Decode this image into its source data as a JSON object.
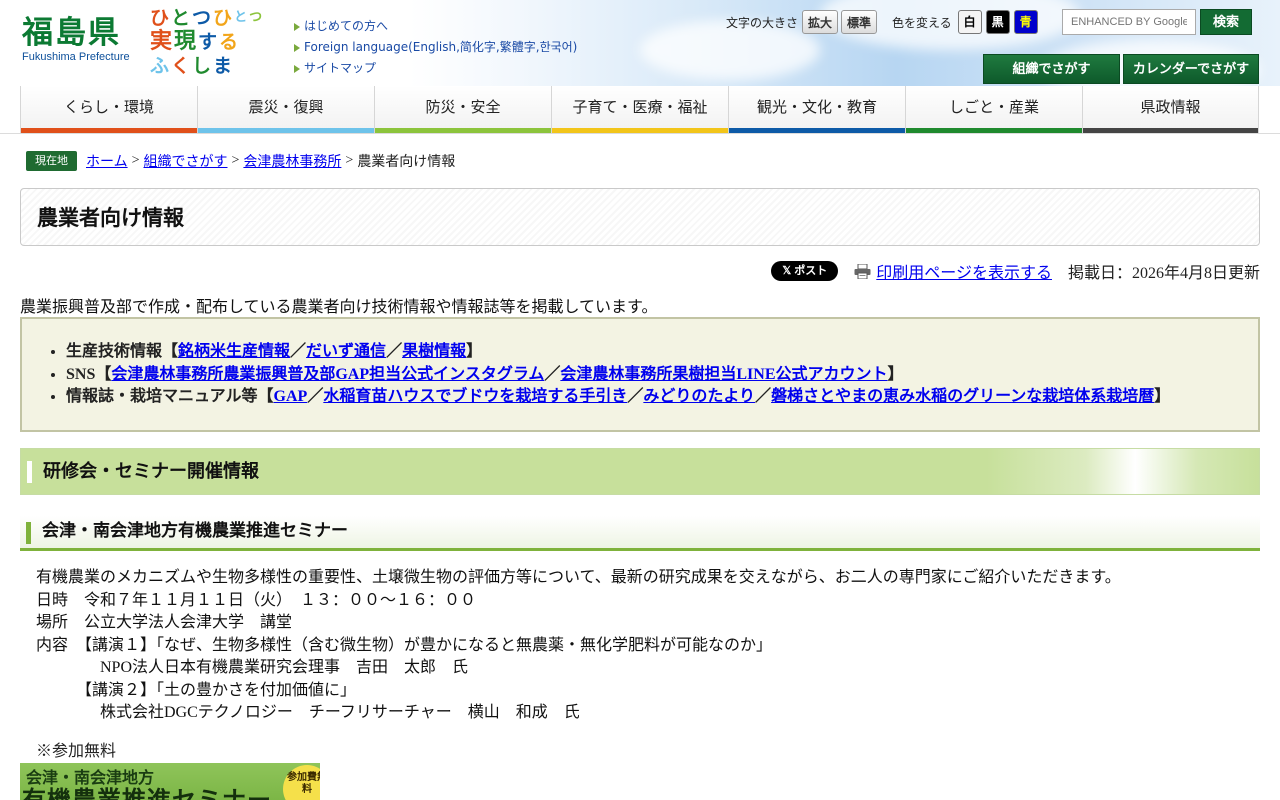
{
  "header": {
    "logo_kanji": "福島県",
    "logo_roman": "Fukushima Prefecture",
    "slogan_chars": [
      "ひ",
      "と",
      "つ",
      "ひ",
      "と",
      "つ",
      "実",
      "現",
      "す",
      "る",
      "ふ",
      "く",
      "し",
      "ま"
    ],
    "top_links": [
      "はじめての方へ",
      "Foreign language(English,简化字,繁體字,한국어)",
      "サイトマップ"
    ],
    "font_size_label": "文字の大きさ",
    "font_enlarge": "拡大",
    "font_standard": "標準",
    "color_change_label": "色を変える",
    "color_white": "白",
    "color_black": "黒",
    "color_blue": "青",
    "search_placeholder": "ENHANCED BY Google",
    "search_button": "検索",
    "org_search_button": "組織でさがす",
    "calendar_search_button": "カレンダーでさがす"
  },
  "nav": [
    {
      "label": "くらし・環境",
      "color": "#e0501a"
    },
    {
      "label": "震災・復興",
      "color": "#6ec3ea"
    },
    {
      "label": "防災・安全",
      "color": "#8cc43c"
    },
    {
      "label": "子育て・医療・福祉",
      "color": "#f2c51a"
    },
    {
      "label": "観光・文化・教育",
      "color": "#0d5aa7"
    },
    {
      "label": "しごと・産業",
      "color": "#1f8a2e"
    },
    {
      "label": "県政情報",
      "color": "#444444"
    }
  ],
  "breadcrumb": {
    "here_label": "現在地",
    "items": [
      "ホーム",
      "組織でさがす",
      "会津農林事務所"
    ],
    "current": "農業者向け情報",
    "separator": ">"
  },
  "page": {
    "title": "農業者向け情報",
    "x_post": "𝕏 ポスト",
    "print_link": "印刷用ページを表示する",
    "updated": "掲載日：2026年4月8日更新",
    "intro": "農業振興普及部で作成・配布している農業者向け技術情報や情報誌等を掲載しています。"
  },
  "linkbox": {
    "rows": [
      {
        "prefix": "生産技術情報【",
        "links": [
          "銘柄米生産情報",
          "だいず通信",
          "果樹情報"
        ],
        "suffix": "】"
      },
      {
        "prefix": "SNS【",
        "links": [
          "会津農林事務所農業振興普及部GAP担当公式インスタグラム",
          "会津農林事務所果樹担当LINE公式アカウント"
        ],
        "suffix": "】"
      },
      {
        "prefix": "情報誌・栽培マニュアル等【",
        "links": [
          "GAP",
          "水稲育苗ハウスでブドウを栽培する手引き",
          "みどりのたより",
          "磐梯さとやまの恵み水稲のグリーンな栽培体系栽培暦"
        ],
        "suffix": "】"
      }
    ],
    "delimiter": "／"
  },
  "section": {
    "h2": "研修会・セミナー開催情報",
    "h3": "会津・南会津地方有機農業推進セミナー",
    "lines": [
      "有機農業のメカニズムや生物多様性の重要性、土壌微生物の評価方等について、最新の研究成果を交えながら、お二人の専門家にご紹介いただきます。",
      "日時　令和７年１１月１１日（火）　１３：００～１６：００",
      "場所　公立大学法人会津大学　講堂",
      "内容　【講演１】「なぜ、生物多様性（含む微生物）が豊かになると無農薬・無化学肥料が可能なのか」",
      "　　　　NPO法人日本有機農業研究会理事　吉田　太郎　氏",
      "　　　【講演２】「土の豊かさを付加価値に」",
      "　　　　株式会社DGCテクノロジー　チーフリサーチャー　横山　和成　氏"
    ],
    "note": "※参加無料",
    "banner_line1": "会津・南会津地方",
    "banner_line2": "有機農業推進セミナー",
    "banner_badge": "参加費無料"
  }
}
